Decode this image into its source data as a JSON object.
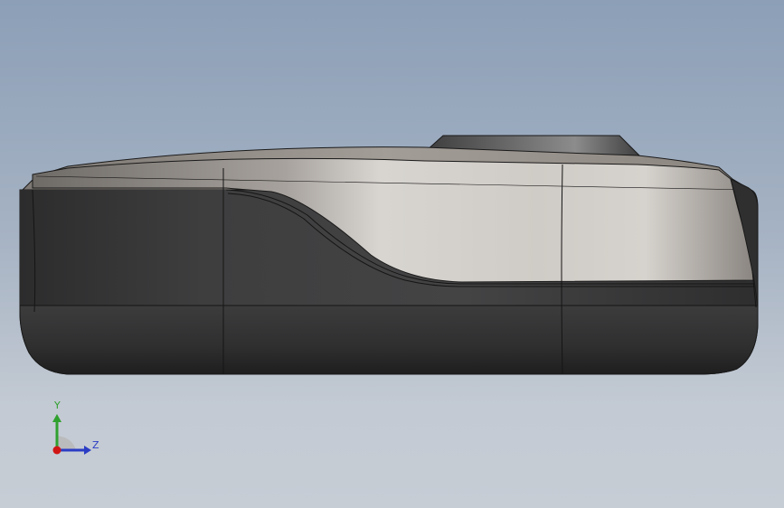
{
  "viewport": {
    "background_top": "#8c9fb7",
    "background_bottom": "#c7cdd5"
  },
  "model": {
    "body_color_dark": "#3a3a3b",
    "body_color_light": "#d4d0ca",
    "edge_color": "#1a1a1a"
  },
  "triad": {
    "y_label": "Y",
    "z_label": "Z",
    "y_color": "#2fa12f",
    "z_color": "#2b3cc4",
    "x_color": "#d01515"
  }
}
